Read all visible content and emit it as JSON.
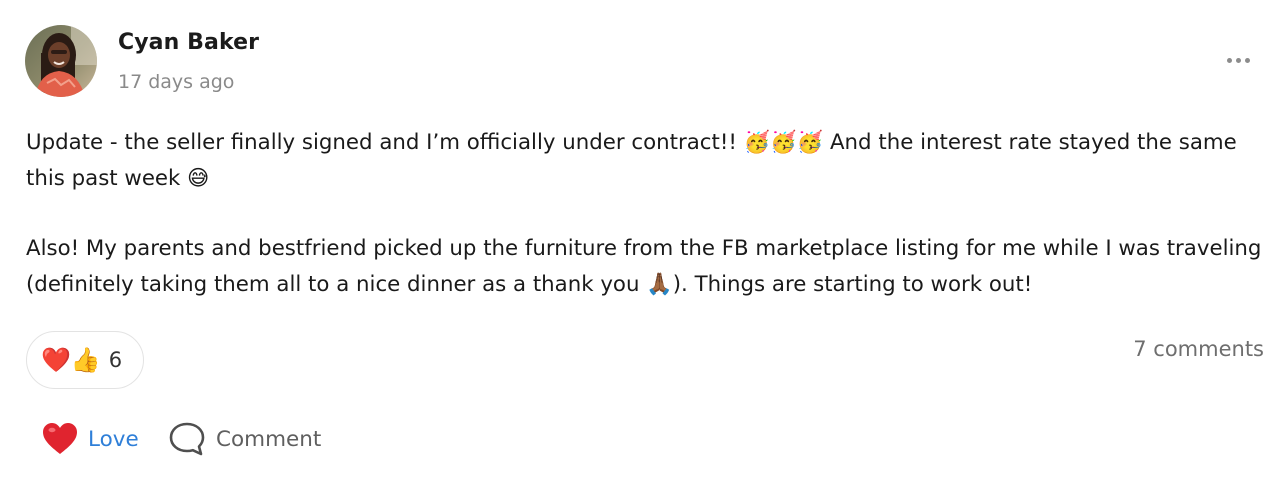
{
  "post": {
    "author": "Cyan Baker",
    "timestamp": "17 days ago",
    "body": {
      "line1_text": "Update - the seller finally signed and I’m officially under contract!! 🥳🥳🥳 And the interest rate stayed the same this past week 😅",
      "line2_text": "Also! My parents and bestfriend picked up the furniture from the FB marketplace listing for me while I was traveling (definitely taking them all to a nice dinner as a thank you 🙏🏾). Things are starting to work out!"
    },
    "reactions": {
      "emojis": "❤️👍",
      "count": "6"
    },
    "comments_label": "7 comments",
    "actions": {
      "love_label": "Love",
      "comment_label": "Comment"
    }
  },
  "icons": {
    "more": "more-options-icon",
    "love": "heart-icon",
    "comment": "comment-bubble-icon"
  },
  "colors": {
    "love_text": "#2f7fd8",
    "heart": "#e0242f",
    "muted_text": "#8a8a8a"
  }
}
